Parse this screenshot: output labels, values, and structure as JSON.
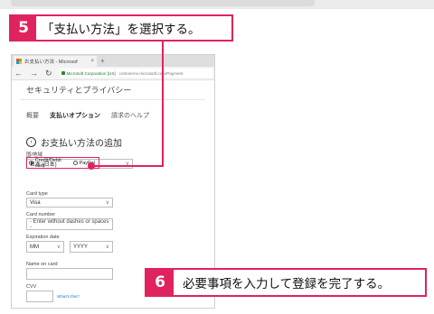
{
  "step5": {
    "number": "5",
    "text": "「支払い方法」を選択する。"
  },
  "step6": {
    "number": "6",
    "text": "必要事項を入力して登録を完了する。"
  },
  "browser": {
    "tab_title": "お支払い方法 - Microsof",
    "tab_close": "×",
    "new_tab": "+",
    "site_identity": "Microsoft Corporation [US]",
    "url": "commerce.microsoft.com/Payment"
  },
  "page": {
    "title": "セキュリティとプライバシー",
    "nav": [
      "概要",
      "支払いオプション",
      "請求のヘルプ"
    ],
    "add_header": "お支払い方法の追加",
    "country_label": "国/地域",
    "country_value": "日本 (日本)",
    "payment_options": [
      "Credit/Debit card",
      "PayPal"
    ],
    "selected_option": "Credit/Debit card",
    "card_type_label": "Card type",
    "card_type_value": "Visa",
    "card_number_label": "Card number",
    "card_number_placeholder": "- Enter without dashes or spaces -",
    "expiration_label": "Expiration date",
    "exp_month": "MM",
    "exp_year": "YYYY",
    "name_label": "Name on card",
    "cvv_label": "CVV",
    "whats_this": "What's this?"
  },
  "colors": {
    "accent": "#e0235f"
  }
}
